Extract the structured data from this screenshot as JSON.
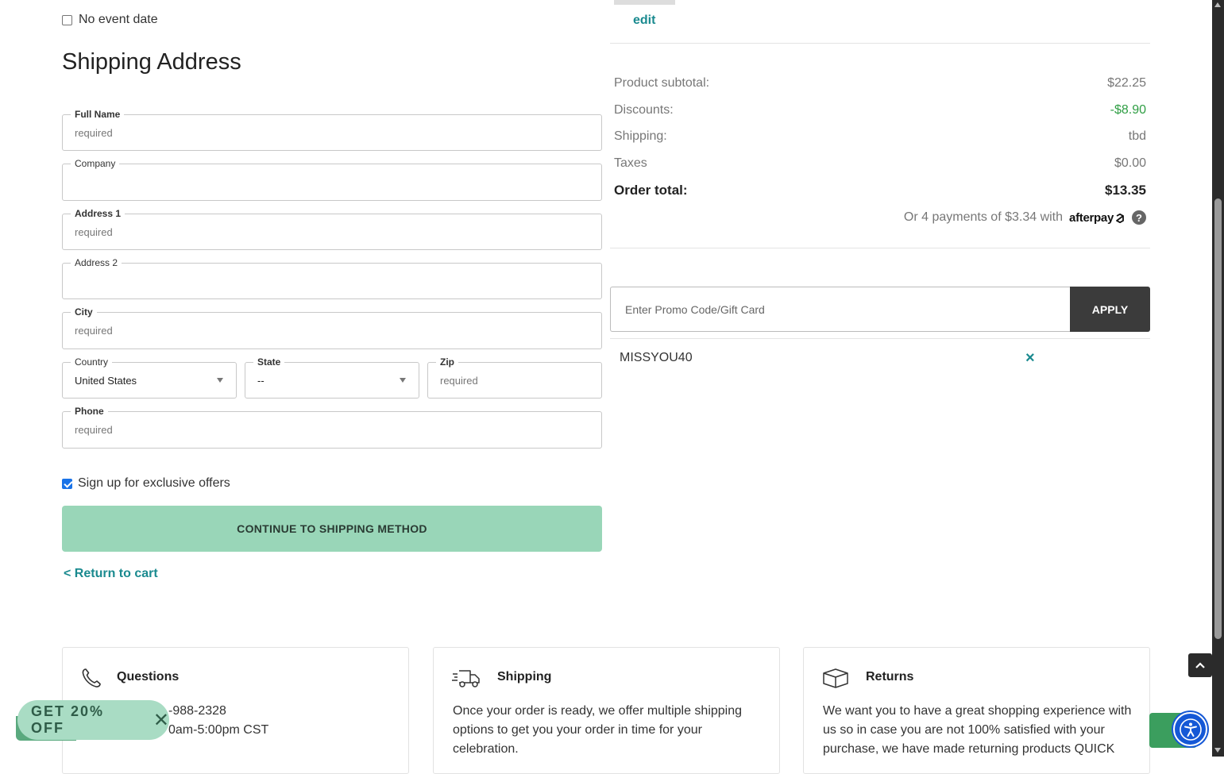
{
  "form": {
    "no_event_date": "No event date",
    "section_title": "Shipping Address",
    "fields": {
      "full_name": {
        "label": "Full Name",
        "placeholder": "required"
      },
      "company": {
        "label": "Company",
        "placeholder": ""
      },
      "address1": {
        "label": "Address 1",
        "placeholder": "required"
      },
      "address2": {
        "label": "Address 2",
        "placeholder": ""
      },
      "city": {
        "label": "City",
        "placeholder": "required"
      },
      "country": {
        "label": "Country",
        "value": "United States"
      },
      "state": {
        "label": "State",
        "value": "--"
      },
      "zip": {
        "label": "Zip",
        "placeholder": "required"
      },
      "phone": {
        "label": "Phone",
        "placeholder": "required"
      }
    },
    "signup_offers": "Sign up for exclusive offers",
    "signup_checked": true,
    "continue_label": "CONTINUE TO SHIPPING METHOD",
    "return_label": "< Return to cart"
  },
  "summary": {
    "edit_label": "edit",
    "rows": [
      {
        "label": "Product subtotal:",
        "value": "$22.25"
      },
      {
        "label": "Discounts:",
        "value": "-$8.90"
      },
      {
        "label": "Shipping:",
        "value": "tbd"
      },
      {
        "label": "Taxes",
        "value": "$0.00"
      }
    ],
    "total_label": "Order total:",
    "total_value": "$13.35",
    "afterpay_text": "Or 4 payments of $3.34 with",
    "afterpay_logo": "afterpay",
    "help_glyph": "?",
    "promo_placeholder": "Enter Promo Code/Gift Card",
    "apply_label": "APPLY",
    "applied_code": "MISSYOU40",
    "remove_glyph": "×"
  },
  "footer": {
    "questions": {
      "title": "Questions",
      "line1": "-988-2328",
      "line2": "0am-5:00pm CST",
      "icon": "phone-icon"
    },
    "shipping": {
      "title": "Shipping",
      "text": "Once your order is ready, we offer multiple shipping options to get you your order in time for your celebration.",
      "icon": "truck-icon"
    },
    "returns": {
      "title": "Returns",
      "text": "We want you to have a great shopping experience with us so in case you are not 100% satisfied with your purchase, we have made returning products QUICK",
      "icon": "box-icon"
    }
  },
  "overlay": {
    "promo_pill": "GET 20% OFF",
    "promo_close": "✕"
  },
  "colors": {
    "accent_teal": "#1a8a8f",
    "continue_green": "#99d6b8",
    "discount_green": "#2f9e44",
    "apply_dark": "#3b3b3b"
  }
}
